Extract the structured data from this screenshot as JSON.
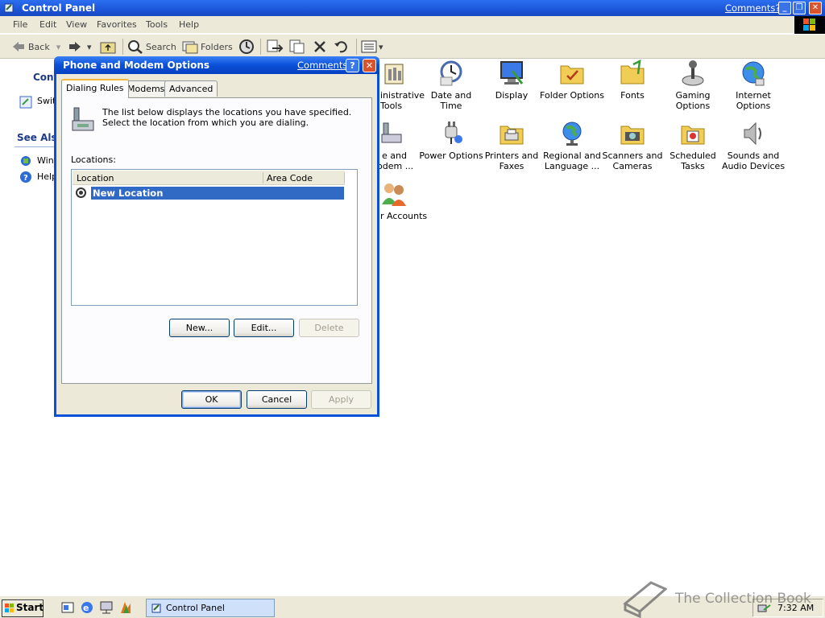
{
  "window": {
    "title": "Control Panel",
    "comments_link": "Comments?"
  },
  "menubar": [
    "File",
    "Edit",
    "View",
    "Favorites",
    "Tools",
    "Help"
  ],
  "toolbar": {
    "back": "Back",
    "search": "Search",
    "folders": "Folders"
  },
  "left_pane": {
    "heading1": "Cont",
    "link1": "Swit",
    "heading2": "See Also",
    "link2": "Wind",
    "link3": "Help"
  },
  "control_panel_items": {
    "admin_tools": [
      "inistrative",
      "Tools"
    ],
    "date_time": "Date and Time",
    "display": "Display",
    "folder_options": "Folder Options",
    "fonts": "Fonts",
    "gaming": [
      "Gaming",
      "Options"
    ],
    "internet": [
      "Internet",
      "Options"
    ],
    "phone_modem": [
      "e and",
      "odem ..."
    ],
    "power": "Power Options",
    "printers": [
      "Printers and",
      "Faxes"
    ],
    "regional": [
      "Regional and",
      "Language ..."
    ],
    "scanners": [
      "Scanners and",
      "Cameras"
    ],
    "scheduled": [
      "Scheduled",
      "Tasks"
    ],
    "sounds": [
      "Sounds and",
      "Audio Devices"
    ],
    "user_accounts": "r Accounts"
  },
  "dialog": {
    "title": "Phone and Modem Options",
    "comments": "Comments?",
    "help_glyph": "?",
    "close_glyph": "✕",
    "tabs": [
      "Dialing Rules",
      "Modems",
      "Advanced"
    ],
    "info": "The list below displays the locations you have specified. Select the location from which you are dialing.",
    "locations_label": "Locations:",
    "columns": [
      "Location",
      "Area Code"
    ],
    "rows": [
      {
        "location": "New Location",
        "area_code": ""
      }
    ],
    "buttons": {
      "new": "New...",
      "edit": "Edit...",
      "delete": "Delete"
    },
    "footer": {
      "ok": "OK",
      "cancel": "Cancel",
      "apply": "Apply"
    }
  },
  "taskbar": {
    "start": "Start",
    "task": "Control Panel",
    "clock": "7:32 AM"
  },
  "watermark": "The Collection Book"
}
